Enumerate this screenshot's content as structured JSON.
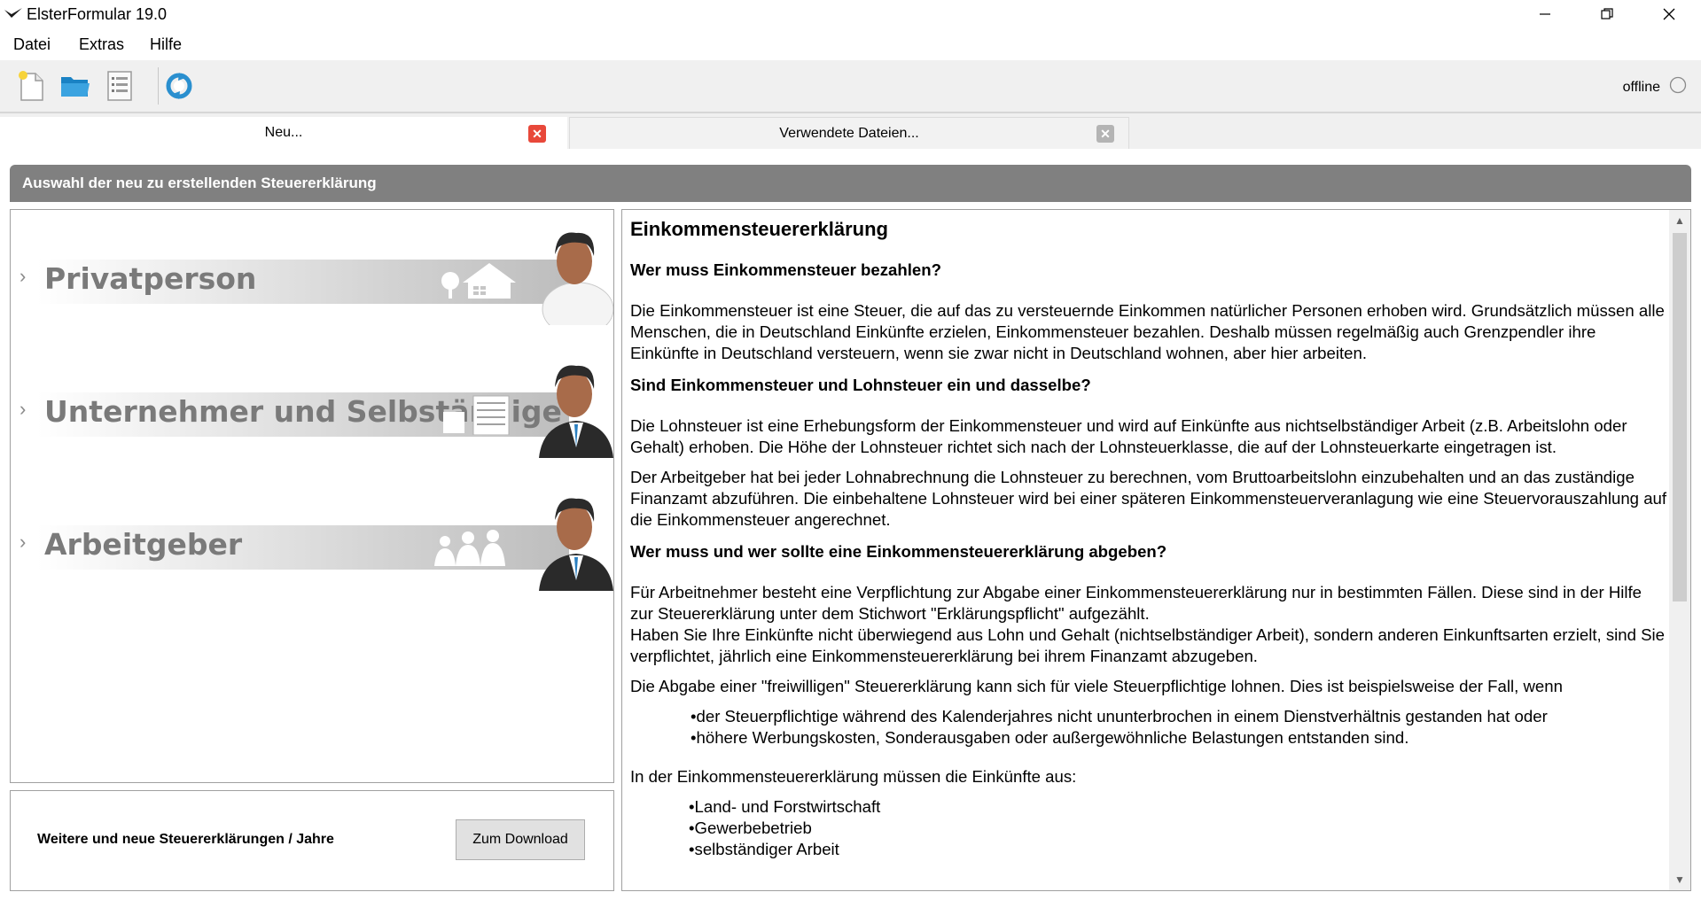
{
  "window": {
    "title": "ElsterFormular 19.0",
    "minimize_icon": "minimize-icon",
    "maximize_icon": "restore-icon",
    "close_icon": "close-icon"
  },
  "menu": {
    "items": [
      "Datei",
      "Extras",
      "Hilfe"
    ]
  },
  "toolbar": {
    "buttons": [
      "new-document-icon",
      "open-folder-icon",
      "list-icon",
      "refresh-icon"
    ],
    "status": "offline",
    "status_icon": "status-circle-icon"
  },
  "tabs": [
    {
      "label": "Neu...",
      "close_color": "#e8483a"
    },
    {
      "label": "Verwendete Dateien...",
      "close_color": "#a8a8a8"
    }
  ],
  "section_title": "Auswahl der neu zu erstellenden Steuererklärung",
  "options": [
    {
      "label": "Privatperson",
      "icon": "private-person-icon"
    },
    {
      "label": "Unternehmer und Selbständige",
      "icon": "businessman-icon"
    },
    {
      "label": "Arbeitgeber",
      "icon": "employer-icon"
    }
  ],
  "download": {
    "label": "Weitere und neue Steuererklärungen / Jahre",
    "button": "Zum Download"
  },
  "content": {
    "title": "Einkommensteuererklärung",
    "q1": "Wer muss Einkommensteuer bezahlen?",
    "p1": "Die Einkommensteuer ist eine Steuer, die auf das zu versteuernde Einkommen natürlicher Personen erhoben wird. Grundsätzlich müssen alle Menschen, die in Deutschland Einkünfte erzielen, Einkommensteuer bezahlen. Deshalb müssen regelmäßig auch Grenzpendler ihre Einkünfte in Deutschland versteuern, wenn sie zwar nicht in Deutschland wohnen, aber hier arbeiten.",
    "q2": "Sind Einkommensteuer und Lohnsteuer ein und dasselbe?",
    "p2": "Die Lohnsteuer ist eine Erhebungsform der Einkommensteuer und wird auf Einkünfte aus nichtselbständiger Arbeit (z.B. Arbeitslohn oder Gehalt) erhoben. Die Höhe der Lohnsteuer richtet sich nach der Lohnsteuerklasse, die auf der Lohnsteuerkarte eingetragen ist.",
    "p3": "Der Arbeitgeber hat bei jeder Lohnabrechnung die Lohnsteuer zu berechnen, vom Bruttoarbeitslohn einzubehalten und an das zuständige Finanzamt abzuführen. Die einbehaltene Lohnsteuer wird bei einer späteren Einkommensteuerveranlagung wie eine Steuervorauszahlung auf die Einkommensteuer angerechnet.",
    "q3": "Wer muss und wer sollte eine Einkommensteuererklärung abgeben?",
    "p4a": "Für Arbeitnehmer besteht eine Verpflichtung zur Abgabe einer Einkommensteuererklärung nur in bestimmten Fällen. Diese sind in der Hilfe zur Steuererklärung unter dem Stichwort \"Erklärungspflicht\" aufgezählt.",
    "p4b": "Haben Sie Ihre Einkünfte nicht überwiegend aus Lohn und Gehalt (nichtselbständiger Arbeit), sondern anderen Einkunftsarten erzielt, sind Sie verpflichtet, jährlich eine Einkommensteuererklärung bei ihrem Finanzamt abzugeben.",
    "p5": "Die Abgabe einer \"freiwilligen\" Steuererklärung kann sich für viele Steuerpflichtige lohnen. Dies ist beispielsweise der Fall, wenn",
    "list1": [
      "der Steuerpflichtige während des Kalenderjahres nicht ununterbrochen in einem Dienstverhältnis gestanden hat oder",
      "höhere Werbungskosten, Sonderausgaben oder außergewöhnliche Belastungen entstanden sind."
    ],
    "p6": "In der Einkommensteuererklärung müssen die Einkünfte aus:",
    "list2": [
      "Land- und Forstwirtschaft",
      "Gewerbebetrieb",
      "selbständiger Arbeit"
    ]
  }
}
